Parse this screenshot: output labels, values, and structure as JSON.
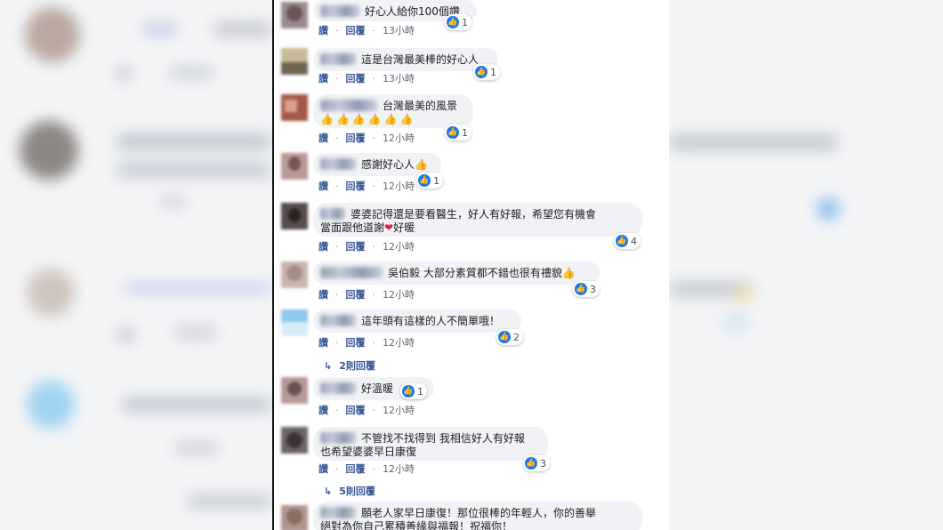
{
  "labels": {
    "like": "讚",
    "reply": "回覆",
    "separator": "·",
    "reply_arrow": "↳"
  },
  "comments": [
    {
      "text": "好心人給你100個讚",
      "reactions": "1",
      "time": "13小時"
    },
    {
      "text": "這是台灣最美棒的好心人",
      "reactions": "1",
      "time": "13小時"
    },
    {
      "text": "台灣最美的風景",
      "text2": "👍👍👍👍👍👍",
      "reactions": "1",
      "time": "12小時"
    },
    {
      "text": "感謝好心人👍",
      "reactions": "1",
      "time": "12小時"
    },
    {
      "text": "婆婆記得還是要看醫生，好人有好報，希望您有機會",
      "text2": "當面跟他道謝",
      "heart": "❤",
      "text3": "好暖",
      "reactions": "4",
      "time": "12小時"
    },
    {
      "text": "吳伯毅 大部分素質都不錯也很有禮貌👍",
      "reactions": "3",
      "time": "12小時"
    },
    {
      "text": "這年頭有這樣的人不簡單哦！",
      "reactions": "2",
      "time": "12小時",
      "replies": "2則回覆"
    },
    {
      "text": "好溫暖",
      "reactions": "1",
      "time": "12小時"
    },
    {
      "text": "不管找不找得到 我相信好人有好報",
      "text2": "也希望婆婆早日康復",
      "reactions": "3",
      "time": "12小時",
      "replies": "5則回覆"
    },
    {
      "text": "願老人家早日康復！那位很棒的年輕人，你的善舉",
      "text2": "絕對為你自己累積善緣與福報！祝福你！"
    }
  ],
  "colors": {
    "bubble": "#f0f2f5",
    "link": "#385898",
    "like_blue": "#1877f2",
    "divider": "#111111"
  }
}
